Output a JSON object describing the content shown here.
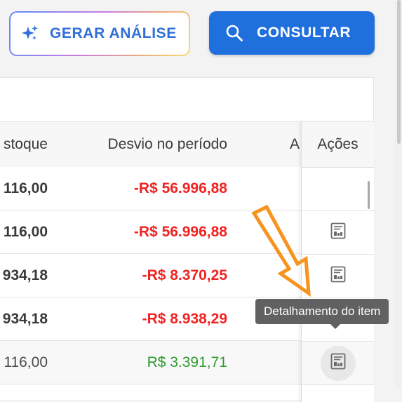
{
  "toolbar": {
    "gerar_analise_label": "GERAR ANÁLISE",
    "consultar_label": "CONSULTAR"
  },
  "table": {
    "headers": {
      "estoque": "stoque",
      "desvio": "Desvio no período",
      "a_partial": "A",
      "acoes": "Ações"
    },
    "rows": [
      {
        "estoque": "116,00",
        "desvio": "-R$ 56.996,88",
        "desvio_color": "#f22222"
      },
      {
        "estoque": "116,00",
        "desvio": "-R$ 56.996,88",
        "desvio_color": "#f22222"
      },
      {
        "estoque": "934,18",
        "desvio": "-R$ 8.370,25",
        "desvio_color": "#f22222"
      },
      {
        "estoque": "934,18",
        "desvio": "-R$ 8.938,29",
        "desvio_color": "#f22222"
      },
      {
        "estoque": "116,00",
        "desvio": "R$ 3.391,71",
        "desvio_color": "#2e9a2e"
      }
    ]
  },
  "tooltip": {
    "text": "Detalhamento do item"
  },
  "colors": {
    "primary": "#1f6fdc",
    "negative": "#f22222",
    "positive": "#2e9a2e",
    "annotation": "#f7931e"
  },
  "icons": {
    "gerar_analise": "sparkle-icon",
    "consultar": "search-icon",
    "row_action": "document-report-icon"
  }
}
